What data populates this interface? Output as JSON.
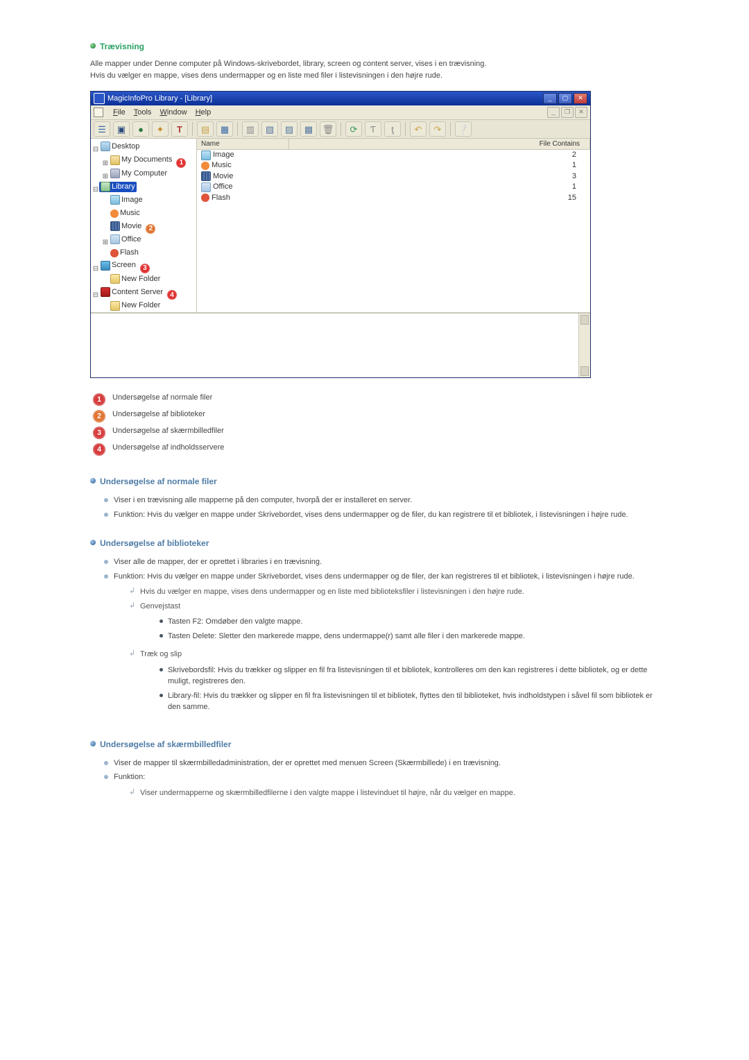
{
  "section_title": "Trævisning",
  "intro_line1": "Alle mapper under Denne computer på Windows-skrivebordet, library, screen og content server, vises i en trævisning.",
  "intro_line2": "Hvis du vælger en mappe, vises dens undermapper og en liste med filer i listevisningen i den højre rude.",
  "window": {
    "title": "MagicInfoPro Library - [Library]",
    "menu": {
      "file": "File",
      "tools": "Tools",
      "window": "Window",
      "help": "Help"
    },
    "toolbar_icons": [
      "tree-icon",
      "monitor-icon",
      "globe-icon",
      "puzzle-icon",
      "text-icon",
      "folder-open-icon",
      "save-icon",
      "sep",
      "page-icon",
      "layer1-icon",
      "layer2-icon",
      "layer3-icon",
      "trash-icon",
      "sep",
      "refresh-icon",
      "text-up-icon",
      "text-down-icon",
      "sep",
      "undo-icon",
      "redo-icon",
      "sep",
      "help-icon"
    ],
    "list_header": {
      "name": "Name",
      "file_contains": "File Contains"
    },
    "list_rows": [
      {
        "icon": "ico-image",
        "name": "Image",
        "count": 2
      },
      {
        "icon": "ico-music",
        "name": "Music",
        "count": 1
      },
      {
        "icon": "ico-movie",
        "name": "Movie",
        "count": 3
      },
      {
        "icon": "ico-office",
        "name": "Office",
        "count": 1
      },
      {
        "icon": "ico-flash",
        "name": "Flash",
        "count": 15
      }
    ],
    "tree": {
      "desktop": "Desktop",
      "my_documents": "My Documents",
      "my_computer": "My Computer",
      "library": "Library",
      "image": "Image",
      "music": "Music",
      "movie": "Movie",
      "office": "Office",
      "flash": "Flash",
      "screen": "Screen",
      "new_folder": "New Folder",
      "content_server": "Content Server"
    }
  },
  "legend": [
    "Undersøgelse af normale filer",
    "Undersøgelse af biblioteker",
    "Undersøgelse af skærmbilledfiler",
    "Undersøgelse af indholdsservere"
  ],
  "sec_normal": {
    "title": "Undersøgelse af normale filer",
    "b1": "Viser i en trævisning alle mapperne på den computer, hvorpå der er installeret en server.",
    "b2": "Funktion: Hvis du vælger en mappe under Skrivebordet, vises dens undermapper og de filer, du kan registrere til et bibliotek, i listevisningen i højre rude."
  },
  "sec_lib": {
    "title": "Undersøgelse af biblioteker",
    "b1": "Viser alle de mapper, der er oprettet i libraries i en trævisning.",
    "b2": "Funktion: Hvis du vælger en mappe under Skrivebordet, vises dens undermapper og de filer, der kan registreres til et bibliotek, i listevisningen i højre rude.",
    "a1": "Hvis du vælger en mappe, vises dens undermapper og en liste med biblioteksfiler i listevisningen i den højre rude.",
    "a2": "Genvejstast",
    "d1": "Tasten F2: Omdøber den valgte mappe.",
    "d2": "Tasten Delete: Sletter den markerede mappe, dens undermappe(r) samt alle filer i den markerede mappe.",
    "a3": "Træk og slip",
    "d3": "Skrivebordsfil: Hvis du trækker og slipper en fil fra listevisningen til et bibliotek, kontrolleres om den kan registreres i dette bibliotek, og er dette muligt, registreres den.",
    "d4": "Library-fil: Hvis du trækker og slipper en fil fra listevisningen til et bibliotek, flyttes den til biblioteket, hvis indholdstypen i såvel fil som bibliotek er den samme."
  },
  "sec_screen": {
    "title": "Undersøgelse af skærmbilledfiler",
    "b1": "Viser de mapper til skærmbilledadministration, der er oprettet med menuen Screen (Skærmbillede) i en trævisning.",
    "b2": "Funktion:",
    "a1": "Viser undermapperne og skærmbilledfilerne i den valgte mappe i listevinduet til højre, når du vælger en mappe."
  }
}
